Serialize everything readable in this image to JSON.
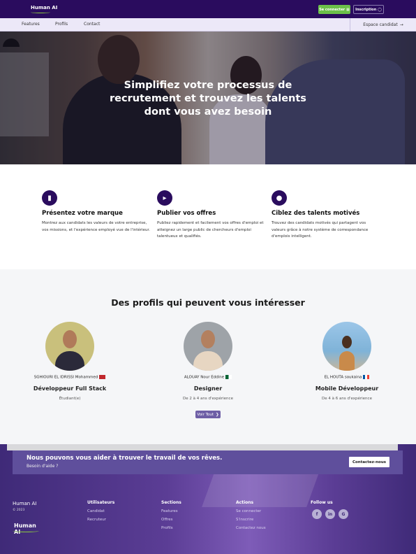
{
  "header": {
    "logo_text": "Human AI",
    "login_label": "Se connecter",
    "register_label": "Inscription"
  },
  "nav": {
    "items": [
      "Features",
      "Profils",
      "Contact"
    ],
    "candidate_space": "Espace candidat"
  },
  "hero": {
    "title": "Simplifiez votre processus de recrutement et trouvez les talents dont vous avez besoin"
  },
  "features": [
    {
      "icon": "bookmark-icon",
      "title": "Présentez votre marque",
      "desc": "Montrez aux candidats les valeurs de votre entreprise, vos missions, et l'expérience employé vue de l'intérieur."
    },
    {
      "icon": "megaphone-icon",
      "title": "Publier vos offres",
      "desc": "Publiez rapidement et facilement vos offres d'emploi et atteignez un large public de chercheurs d'emploi talentueux et qualifiés."
    },
    {
      "icon": "user-check-icon",
      "title": "Ciblez des talents motivés",
      "desc": "Trouvez des candidats motivés qui partagent vos valeurs grâce à notre système de correspondance d'emplois intelligent."
    }
  ],
  "profiles": {
    "title": "Des profils qui peuvent vous intéresser",
    "items": [
      {
        "name": "SGHIOURI EL IDRISSI Mohammed",
        "flag": "morocco-flag",
        "role": "Développeur Full Stack",
        "experience": "Étudiant(e)"
      },
      {
        "name": "ALOUAY Nour Eddine",
        "flag": "algeria-flag",
        "role": "Designer",
        "experience": "De 2 à 4 ans d'expérience"
      },
      {
        "name": "EL HOUTA soukaina",
        "flag": "france-flag",
        "role": "Mobile Développeur",
        "experience": "De 4 à 6 ans d'expérience"
      }
    ],
    "view_all": "Voir Tout"
  },
  "cta": {
    "title": "Nous pouvons vous aider à trouver le travail de vos rêves.",
    "subtitle": "Besoin d'aide ?",
    "button": "Contactez-nous"
  },
  "footer": {
    "brand": "Human AI",
    "copyright": "© 2023",
    "logo_text": "Human AI",
    "columns": [
      {
        "title": "Utilisateurs",
        "links": [
          "Candidat",
          "Recruteur"
        ]
      },
      {
        "title": "Sections",
        "links": [
          "Features",
          "Offres",
          "Profils"
        ]
      },
      {
        "title": "Actions",
        "links": [
          "Se connecter",
          "S'inscrire",
          "Contactez nous"
        ]
      }
    ],
    "follow_title": "Follow us",
    "social": [
      "facebook-icon",
      "linkedin-icon",
      "google-icon"
    ]
  },
  "colors": {
    "brand_dark": "#2a0c5e",
    "login_green": "#6cc04a",
    "footer_purple": "#5b3d95"
  }
}
